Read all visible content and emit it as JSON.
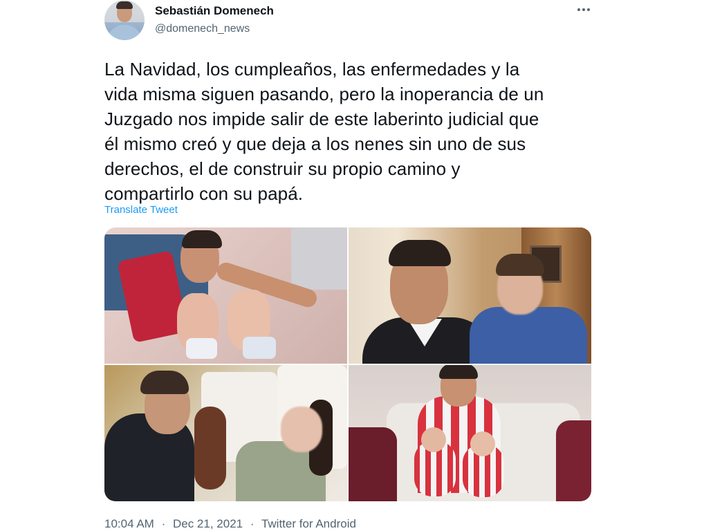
{
  "author": {
    "display_name": "Sebastián Domenech",
    "handle": "@domenech_news",
    "avatar_icon": "profile-photo"
  },
  "tweet": {
    "text": "La Navidad, los cumpleaños, las enfermedades y la\nvida misma siguen pasando, pero la inoperancia de un\nJuzgado nos impide salir de este laberinto judicial que\nél mismo creó y que deja a los nenes sin uno de sus\nderechos, el de construir su propio camino y\ncompartirlo con su papá.",
    "translate_label": "Translate Tweet"
  },
  "media": {
    "photo_count": 4
  },
  "meta": {
    "time": "10:04 AM",
    "date": "Dec 21, 2021",
    "source": "Twitter for Android",
    "separator": "·"
  },
  "colors": {
    "text_primary": "#0f1419",
    "text_secondary": "#536471",
    "link": "#1d9bf0"
  },
  "icons": {
    "more": "more-horizontal-icon"
  }
}
